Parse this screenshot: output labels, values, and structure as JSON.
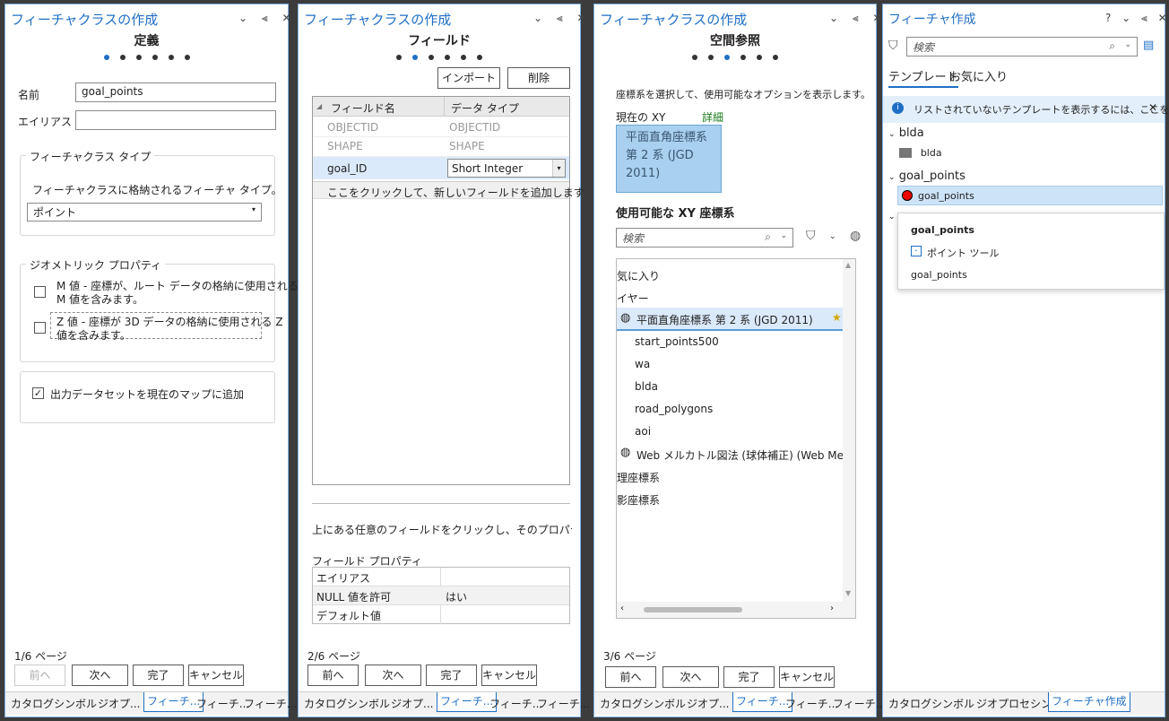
{
  "p1": {
    "title": "フィーチャクラスの作成",
    "controls": "⌄ ⫷ ✕",
    "step": "定義",
    "name_label": "名前",
    "name_value": "goal_points",
    "alias_label": "エイリアス",
    "fc_type_group": "フィーチャクラス タイプ",
    "fc_type_desc": "フィーチャクラスに格納されるフィーチャ タイプ。",
    "fc_type_value": "ポイント",
    "geom_group": "ジオメトリック プロパティ",
    "m_line1": "M 値 - 座標が、ルート データの格納に使用される",
    "m_line2": "M 値を含みます。",
    "z_line1": "Z 値 - 座標が 3D データの格納に使用される Z",
    "z_line2": "値を含みます。",
    "add_to_map": "出力データセットを現在のマップに追加",
    "page": "1/6 ページ",
    "prev": "前へ",
    "next": "次へ",
    "finish": "完了",
    "cancel": "キャンセル",
    "tabs": [
      "カタログ",
      "シンボル",
      "ジオプ...",
      "フィーチ...",
      "フィーチ...",
      "フィーチ..."
    ]
  },
  "p2": {
    "title": "フィーチャクラスの作成",
    "step": "フィールド",
    "import": "インポート",
    "delete": "削除",
    "col_name": "フィールド名",
    "col_type": "データ タイプ",
    "rows": [
      [
        "OBJECTID",
        "OBJECTID"
      ],
      [
        "SHAPE",
        "SHAPE"
      ],
      [
        "goal_ID",
        "Short Integer"
      ]
    ],
    "add_hint": "ここをクリックして、新しいフィールドを追加します",
    "click_hint": "上にある任意のフィールドをクリックし、そのプロパティを表示しま",
    "props_label": "フィールド プロパティ",
    "props": [
      [
        "エイリアス",
        ""
      ],
      [
        "NULL 値を許可",
        "はい"
      ],
      [
        "デフォルト値",
        ""
      ]
    ],
    "page": "2/6 ページ",
    "prev": "前へ",
    "next": "次へ",
    "finish": "完了",
    "cancel": "キャンセル",
    "tabs": [
      "カタログ",
      "シンボル",
      "ジオプ...",
      "フィーチ...",
      "フィーチ...",
      "フィーチ..."
    ]
  },
  "p3": {
    "title": "フィーチャクラスの作成",
    "step": "空間参照",
    "desc": "座標系を選択して、使用可能なオプションを表示します。",
    "current_xy": "現在の XY",
    "details": "詳細",
    "cs_line1": "平面直角座標系",
    "cs_line2": "第 2 系 (JGD",
    "cs_line3": "2011)",
    "avail": "使用可能な XY 座標系",
    "search": "検索",
    "list": [
      "気に入り",
      "イヤー",
      "平面直角座標系 第 2 系 (JGD 2011)",
      "start_points500",
      "wa",
      "blda",
      "road_polygons",
      "aoi",
      "Web メルカトル図法 (球体補正) (Web Mercat",
      "理座標系",
      "影座標系"
    ],
    "page": "3/6 ページ",
    "prev": "前へ",
    "next": "次へ",
    "finish": "完了",
    "cancel": "キャンセル",
    "tabs": [
      "カタログ",
      "シンボル",
      "ジオプ...",
      "フィーチ...",
      "フィーチ...",
      "フィーチ..."
    ]
  },
  "p4": {
    "title": "フィーチャ作成",
    "controls": "? ⌄ ⫷ ✕",
    "search": "検索",
    "tab_templates": "テンプレート",
    "tab_fav": "お気に入り",
    "info": "リストされていないテンプレートを表示するには、ここを/",
    "g1": "blda",
    "g1_item": "blda",
    "g2": "goal_points",
    "g2_item": "goal_points",
    "popup_title": "goal_points",
    "popup_tool": "ポイント ツール",
    "popup_item": "goal_points",
    "tabs": [
      "カタログ",
      "シンボル",
      "ジオプロセシング",
      "フィーチャ作成"
    ]
  }
}
